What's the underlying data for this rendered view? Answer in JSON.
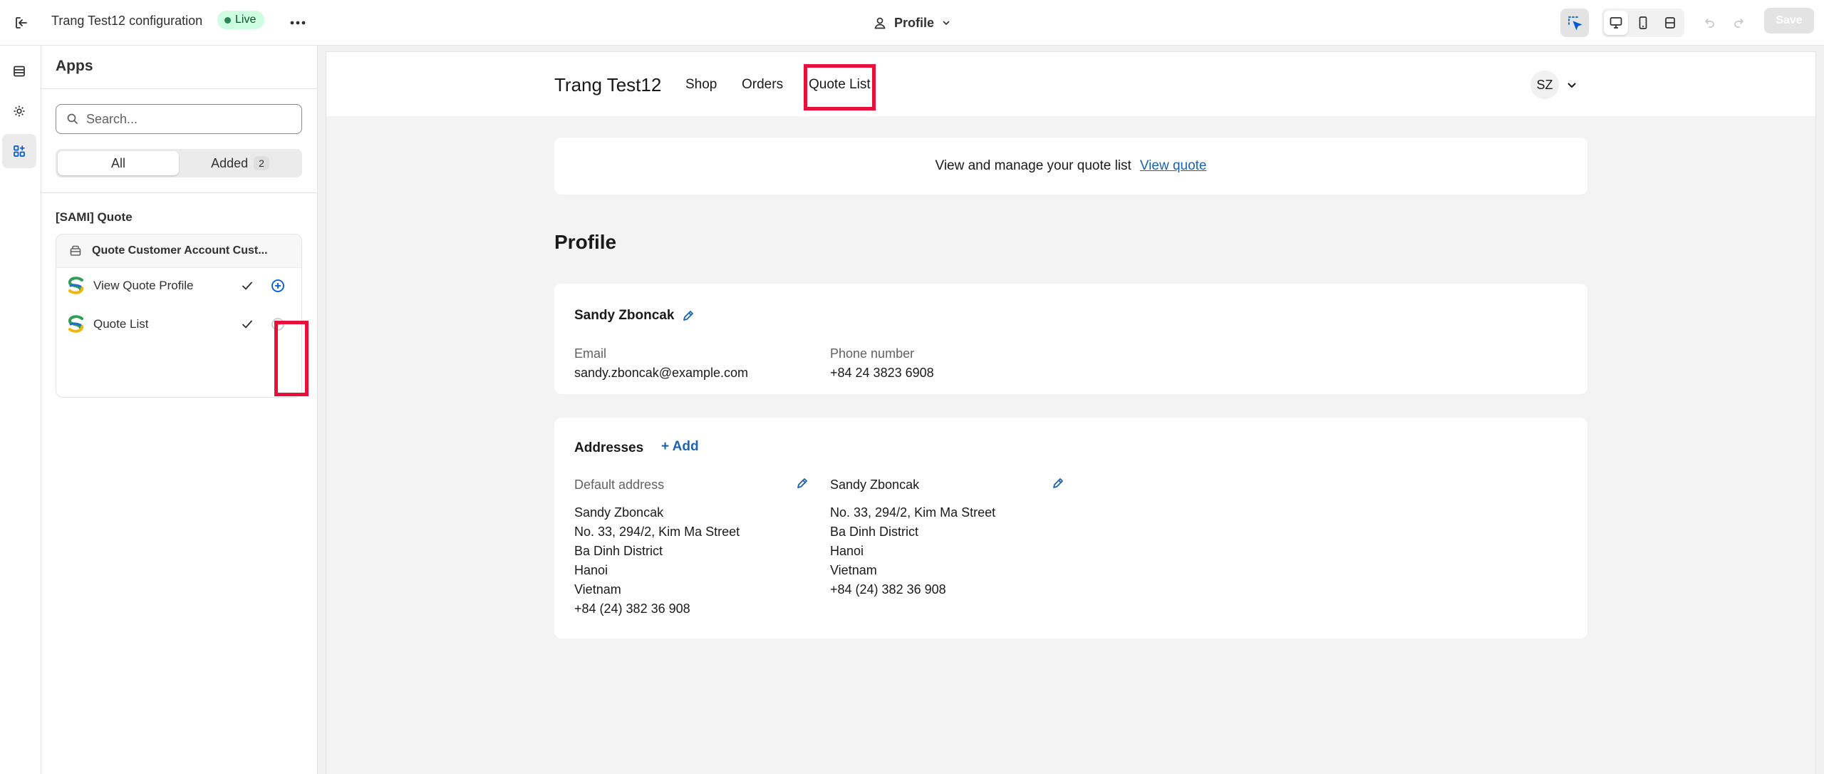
{
  "topbar": {
    "store_title": "Trang Test12 configuration",
    "status_badge": "Live",
    "page_selector": "Profile",
    "save_label": "Save"
  },
  "panel": {
    "title": "Apps",
    "search_placeholder": "Search...",
    "filter_all": "All",
    "filter_added": "Added",
    "added_count": "2",
    "group_title": "[SAMI] Quote",
    "app_name": "Quote Customer Account Cust...",
    "blocks": [
      {
        "label": "View Quote Profile"
      },
      {
        "label": "Quote List"
      }
    ]
  },
  "site": {
    "shop_name": "Trang Test12",
    "nav": [
      "Shop",
      "Orders",
      "Quote List"
    ],
    "avatar_initials": "SZ"
  },
  "banner": {
    "text": "View and manage your quote list",
    "link": "View quote"
  },
  "profile": {
    "heading": "Profile",
    "name": "Sandy Zboncak",
    "email_label": "Email",
    "email": "sandy.zboncak@example.com",
    "phone_label": "Phone number",
    "phone": "+84 24 3823 6908"
  },
  "addresses": {
    "title": "Addresses",
    "add_label": "+ Add",
    "default_label": "Default address",
    "second_label": "Sandy Zboncak",
    "default_lines": [
      "Sandy Zboncak",
      "No. 33, 294/2, Kim Ma Street",
      "Ba Dinh District",
      "Hanoi",
      "Vietnam",
      "+84 (24) 382 36 908"
    ],
    "second_lines": [
      "No. 33, 294/2, Kim Ma Street",
      "Ba Dinh District",
      "Hanoi",
      "Vietnam",
      "+84 (24) 382 36 908"
    ]
  },
  "colors": {
    "highlight": "#e8103a",
    "link": "#1c63b0",
    "live_badge_bg": "#cdfee1",
    "add_block_icon": "#005bd3"
  }
}
